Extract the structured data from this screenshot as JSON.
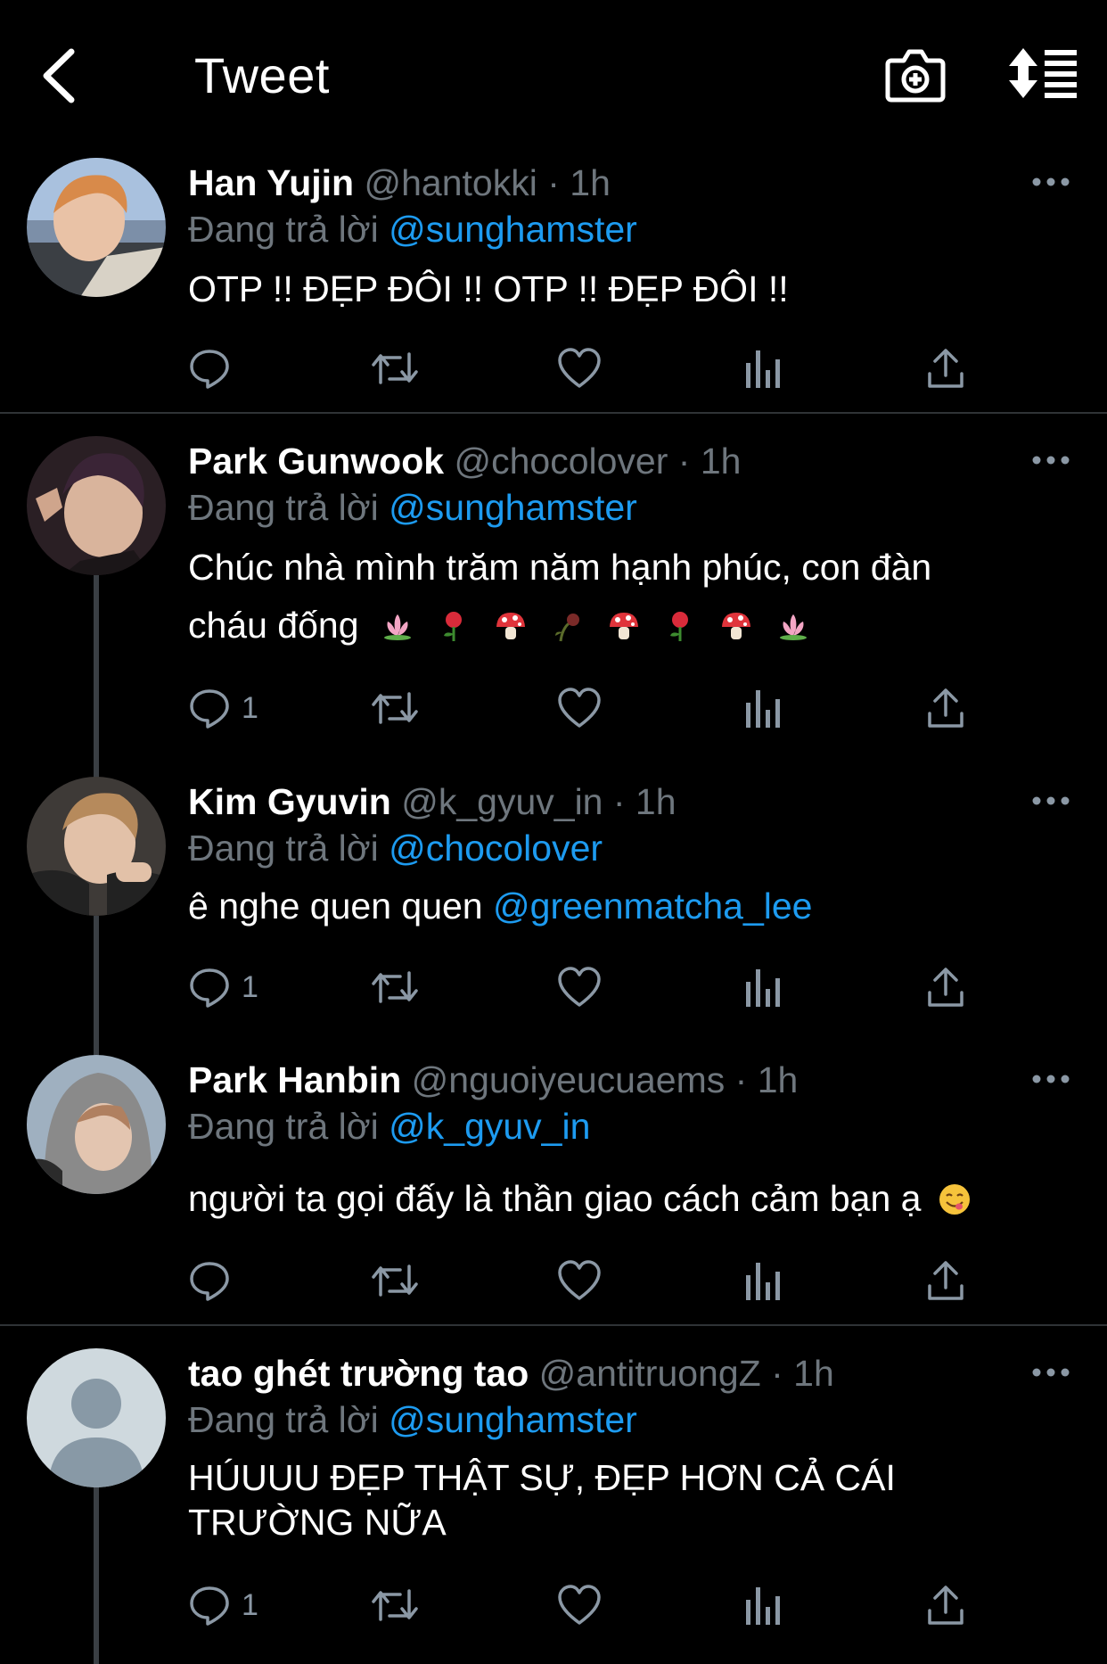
{
  "header": {
    "title": "Tweet"
  },
  "reply_prefix": "Đang trả lời",
  "tweets": [
    {
      "name": "Han Yujin",
      "handle": "@hantokki",
      "time": "· 1h",
      "reply_to": "@sunghamster",
      "text": "OTP !! ĐẸP ĐÔI !! OTP !! ĐẸP ĐÔI !!",
      "reply_count": ""
    },
    {
      "name": "Park Gunwook",
      "handle": "@chocolover",
      "time": "· 1h",
      "reply_to": "@sunghamster",
      "text_line1": "Chúc nhà mình trăm năm hạnh phúc, con đàn",
      "text_line2": "cháu đống",
      "emojis": [
        "lotus",
        "rose",
        "mushroom",
        "wilted-rose",
        "mushroom",
        "rose",
        "mushroom",
        "lotus"
      ],
      "reply_count": "1"
    },
    {
      "name": "Kim Gyuvin",
      "handle": "@k_gyuv_in",
      "time": "· 1h",
      "reply_to": "@chocolover",
      "text": "ê nghe quen quen",
      "mention": "@greenmatcha_lee",
      "reply_count": "1"
    },
    {
      "name": "Park Hanbin",
      "handle": "@nguoiyeucuaems",
      "time": "· 1h",
      "reply_to": "@k_gyuv_in",
      "text": "người ta gọi đấy là thần giao cách cảm bạn ạ",
      "emoji": "yum-face",
      "reply_count": ""
    },
    {
      "name": "tao ghét trường tao",
      "handle": "@antitruongZ",
      "time": "· 1h",
      "reply_to": "@sunghamster",
      "text_line1": "HÚUUU ĐẸP THẬT SỰ, ĐẸP HƠN CẢ CÁI",
      "text_line2": "TRƯỜNG NỮA",
      "reply_count": "1"
    }
  ],
  "icons": {
    "back": "chevron-left-icon",
    "camera": "camera-plus-icon",
    "sort": "sort-icon",
    "reply": "reply-icon",
    "retweet": "retweet-icon",
    "like": "heart-icon",
    "views": "analytics-icon",
    "share": "share-icon",
    "more": "more-icon"
  },
  "colors": {
    "background": "#000000",
    "link": "#1d9bf0",
    "muted": "#6e767d"
  }
}
